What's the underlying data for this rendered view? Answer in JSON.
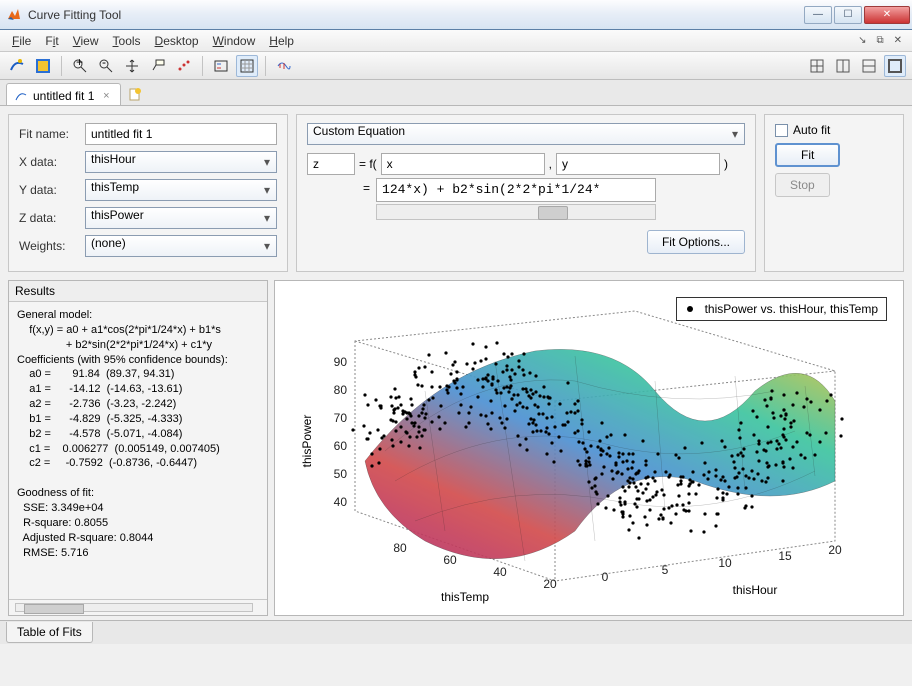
{
  "window": {
    "title": "Curve Fitting Tool"
  },
  "menu": {
    "file": "File",
    "fit": "Fit",
    "view": "View",
    "tools": "Tools",
    "desktop": "Desktop",
    "window": "Window",
    "help": "Help"
  },
  "tabs": {
    "active": "untitled fit 1"
  },
  "left": {
    "fitname_lbl": "Fit name:",
    "fitname": "untitled fit 1",
    "xdata_lbl": "X data:",
    "xdata": "thisHour",
    "ydata_lbl": "Y data:",
    "ydata": "thisTemp",
    "zdata_lbl": "Z data:",
    "zdata": "thisPower",
    "weights_lbl": "Weights:",
    "weights": "(none)"
  },
  "mid": {
    "eqtype": "Custom Equation",
    "zvar": "z",
    "eq_prefix": "= f(",
    "xvar": "x",
    "comma": ",",
    "yvar": "y",
    "eq_suffix": ")",
    "eq_eq": "=",
    "eq_body": "124*x) + b2*sin(2*2*pi*1/24*",
    "fitopts": "Fit Options..."
  },
  "right": {
    "autofit": "Auto fit",
    "fit": "Fit",
    "stop": "Stop"
  },
  "results": {
    "hdr": "Results",
    "body": "General model:\n    f(x,y) = a0 + a1*cos(2*pi*1/24*x) + b1*s\n                + b2*sin(2*2*pi*1/24*x) + c1*y\nCoefficients (with 95% confidence bounds):\n    a0 =       91.84  (89.37, 94.31)\n    a1 =      -14.12  (-14.63, -13.61)\n    a2 =      -2.736  (-3.23, -2.242)\n    b1 =      -4.829  (-5.325, -4.333)\n    b2 =      -4.578  (-5.071, -4.084)\n    c1 =    0.006277  (0.005149, 0.007405)\n    c2 =     -0.7592  (-0.8736, -0.6447)\n\nGoodness of fit:\n  SSE: 3.349e+04\n  R-square: 0.8055\n  Adjusted R-square: 0.8044\n  RMSE: 5.716"
  },
  "plot": {
    "legend": "thisPower vs. thisHour, thisTemp",
    "zlabel": "thisPower",
    "xlabel": "thisHour",
    "ylabel": "thisTemp",
    "z_ticks": [
      "40",
      "50",
      "60",
      "70",
      "80",
      "90"
    ],
    "x_ticks": [
      "0",
      "5",
      "10",
      "15",
      "20"
    ],
    "y_ticks": [
      "20",
      "40",
      "60",
      "80"
    ]
  },
  "bottom": {
    "tof": "Table of Fits"
  },
  "chart_data": {
    "type": "surface3d_with_scatter",
    "title": "thisPower vs. thisHour, thisTemp",
    "xlabel": "thisHour",
    "ylabel": "thisTemp",
    "zlabel": "thisPower",
    "x_range": [
      0,
      24
    ],
    "y_range": [
      15,
      90
    ],
    "z_range": [
      35,
      95
    ],
    "model": "a0 + a1*cos(2*pi*1/24*x) + b1*sin(2*pi*1/24*x) + a2*cos(2*2*pi*1/24*x) + b2*sin(2*2*pi*1/24*x) + c1*y + c2*?",
    "coefficients": {
      "a0": 91.84,
      "a1": -14.12,
      "a2": -2.736,
      "b1": -4.829,
      "b2": -4.578,
      "c1": 0.006277,
      "c2": -0.7592
    },
    "goodness_of_fit": {
      "SSE": 33490,
      "R_square": 0.8055,
      "Adj_R_square": 0.8044,
      "RMSE": 5.716
    },
    "scatter_note": "dense black scatter of thisPower over (thisHour, thisTemp) grid, visually clustered 40–95"
  }
}
